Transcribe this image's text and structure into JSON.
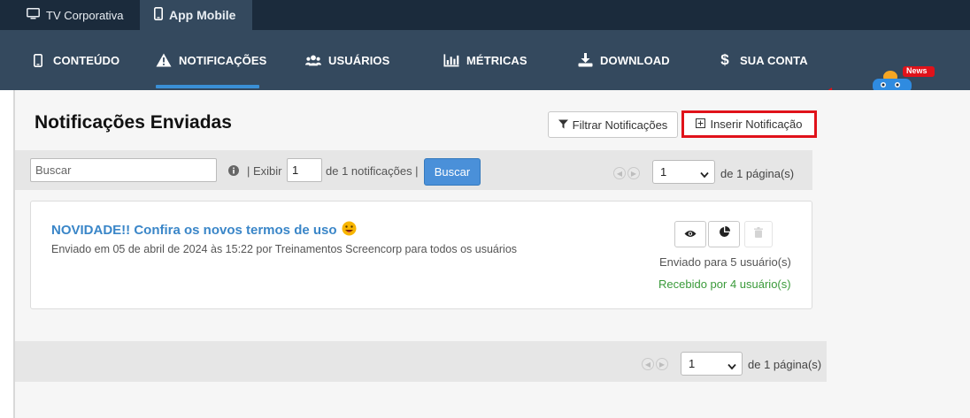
{
  "top_tabs": [
    {
      "label": "TV Corporativa",
      "icon": "monitor-icon"
    },
    {
      "label": "App Mobile",
      "icon": "smartphone-icon"
    }
  ],
  "nav": {
    "items": [
      {
        "label": "CONTEÚDO",
        "icon": "smartphone-icon"
      },
      {
        "label": "NOTIFICAÇÕES",
        "icon": "warning-icon",
        "active": true
      },
      {
        "label": "USUÁRIOS",
        "icon": "users-icon"
      },
      {
        "label": "MÉTRICAS",
        "icon": "bar-chart-icon"
      },
      {
        "label": "DOWNLOAD",
        "icon": "download-icon"
      },
      {
        "label": "SUA CONTA",
        "icon": "dollar-icon"
      }
    ],
    "news_badge": "News"
  },
  "page": {
    "title": "Notificações Enviadas",
    "filter_button": "Filtrar Notificações",
    "insert_button": "Inserir Notificação"
  },
  "toolbar": {
    "search_placeholder": "Buscar",
    "exibir_label": "| Exibir",
    "exibir_value": "1",
    "count_label": "de 1 notificações |",
    "search_button": "Buscar",
    "page_value": "1",
    "page_total": "de 1 página(s)"
  },
  "notifications": [
    {
      "title": "NOVIDADE!! Confira os novos termos de uso",
      "meta": "Enviado em 05 de abril de 2024 às 15:22 por Treinamentos Screencorp para todos os usuários",
      "sent": "Enviado para 5 usuário(s)",
      "received": "Recebido por 4 usuário(s)"
    }
  ],
  "bottom_pager": {
    "page_value": "1",
    "page_total": "de 1 página(s)"
  },
  "colors": {
    "topbar": "#1b2b3c",
    "nav": "#34495e",
    "accent": "#3a8fd6",
    "highlight": "#e0121a",
    "received": "#3a9a3a"
  }
}
